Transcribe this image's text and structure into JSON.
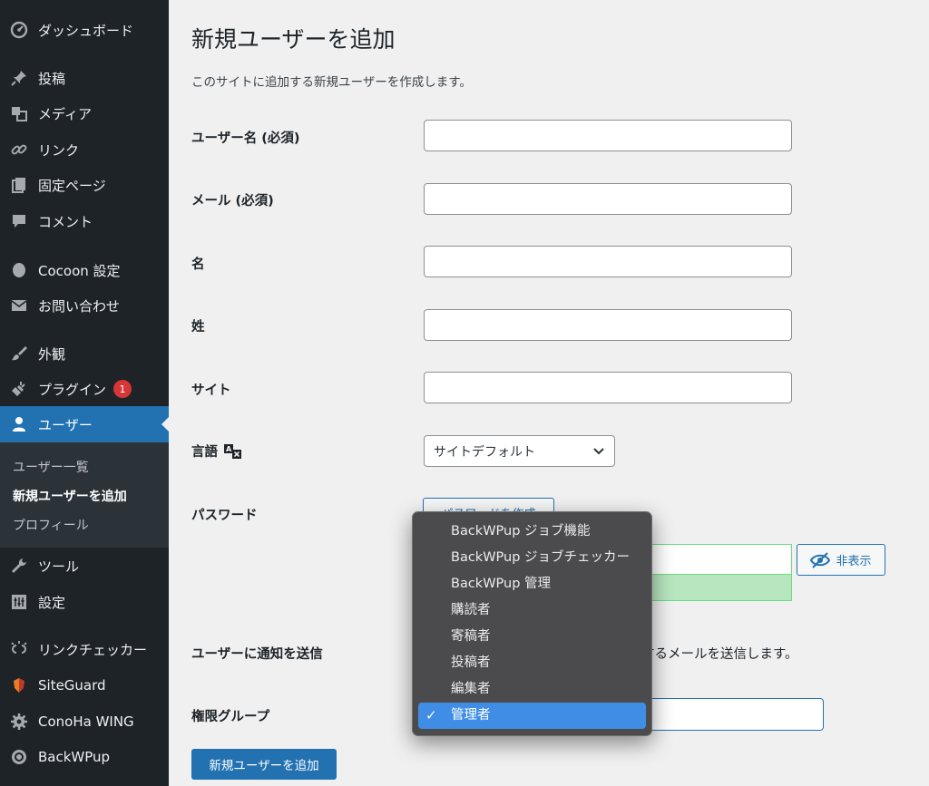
{
  "sidebar": {
    "items": [
      {
        "label": "ダッシュボード",
        "icon": "dashboard-icon"
      },
      {
        "label": "投稿",
        "icon": "pin-icon"
      },
      {
        "label": "メディア",
        "icon": "media-icon"
      },
      {
        "label": "リンク",
        "icon": "link-icon"
      },
      {
        "label": "固定ページ",
        "icon": "pages-icon"
      },
      {
        "label": "コメント",
        "icon": "comment-icon"
      },
      {
        "label": "Cocoon 設定",
        "icon": "cocoon-icon"
      },
      {
        "label": "お問い合わせ",
        "icon": "mail-icon"
      },
      {
        "label": "外観",
        "icon": "brush-icon"
      },
      {
        "label": "プラグイン",
        "icon": "plugin-icon",
        "badge": "1"
      },
      {
        "label": "ユーザー",
        "icon": "user-icon"
      },
      {
        "label": "ツール",
        "icon": "wrench-icon"
      },
      {
        "label": "設定",
        "icon": "settings-icon"
      },
      {
        "label": "リンクチェッカー",
        "icon": "broken-link-icon"
      },
      {
        "label": "SiteGuard",
        "icon": "siteguard-icon"
      },
      {
        "label": "ConoHa WING",
        "icon": "gear-icon"
      },
      {
        "label": "BackWPup",
        "icon": "backwpup-icon"
      }
    ],
    "submenu": [
      "ユーザー一覧",
      "新規ユーザーを追加",
      "プロフィール"
    ]
  },
  "page": {
    "title": "新規ユーザーを追加",
    "description": "このサイトに追加する新規ユーザーを作成します。"
  },
  "form": {
    "username_label": "ユーザー名 (必須)",
    "email_label": "メール (必須)",
    "firstname_label": "名",
    "lastname_label": "姓",
    "site_label": "サイト",
    "language_label": "言語",
    "language_value": "サイトデフォルト",
    "password_label": "パスワード",
    "generate_password_button": "パスワードを作成",
    "hide_button": "非表示",
    "notify_label": "ユーザーに通知を送信",
    "notify_text": "するメールを送信します。",
    "role_label": "権限グループ",
    "submit_button": "新規ユーザーを追加"
  },
  "role_dropdown": {
    "options": [
      "BackWPup ジョブ機能",
      "BackWPup ジョブチェッカー",
      "BackWPup 管理",
      "購読者",
      "寄稿者",
      "投稿者",
      "編集者",
      "管理者"
    ],
    "selected": "管理者",
    "check": "✓"
  },
  "colors": {
    "sidebar_bg": "#1d2327",
    "accent": "#2271b1",
    "badge": "#d63638",
    "popup_bg": "#4b4b4d",
    "popup_selected": "#3f8de4"
  }
}
